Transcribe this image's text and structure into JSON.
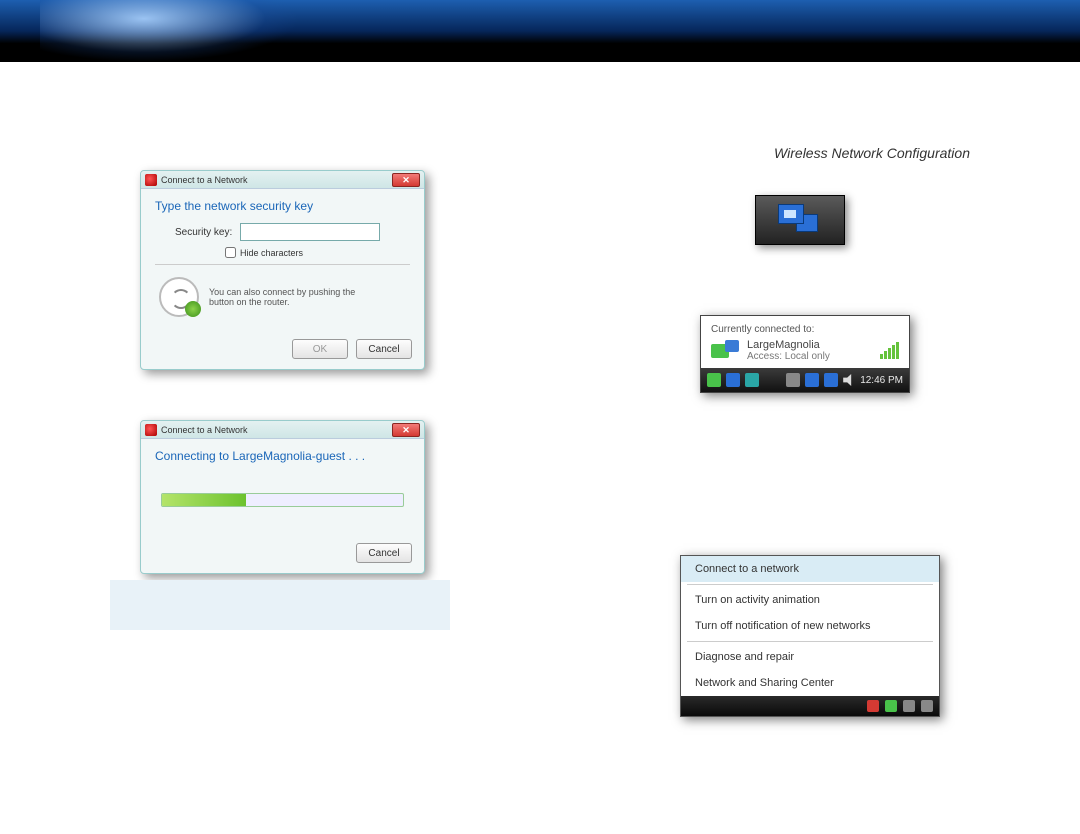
{
  "section_title": "Wireless Network Configuration",
  "dlg1": {
    "title": "Connect to a Network",
    "close": "✕",
    "heading": "Type the network security key",
    "key_label": "Security key:",
    "hide_label": "Hide characters",
    "hint": "You can also connect by pushing the button on the router.",
    "ok": "OK",
    "cancel": "Cancel"
  },
  "dlg2": {
    "title": "Connect to a Network",
    "close": "✕",
    "heading": "Connecting to LargeMagnolia-guest . . .",
    "cancel": "Cancel"
  },
  "popup": {
    "label": "Currently connected to:",
    "name": "LargeMagnolia",
    "access": "Access:  Local only",
    "time": "12:46 PM"
  },
  "menu": {
    "i1": "Connect to a network",
    "i2": "Turn on activity animation",
    "i3": "Turn off notification of new networks",
    "i4": "Diagnose and repair",
    "i5": "Network and Sharing Center"
  }
}
